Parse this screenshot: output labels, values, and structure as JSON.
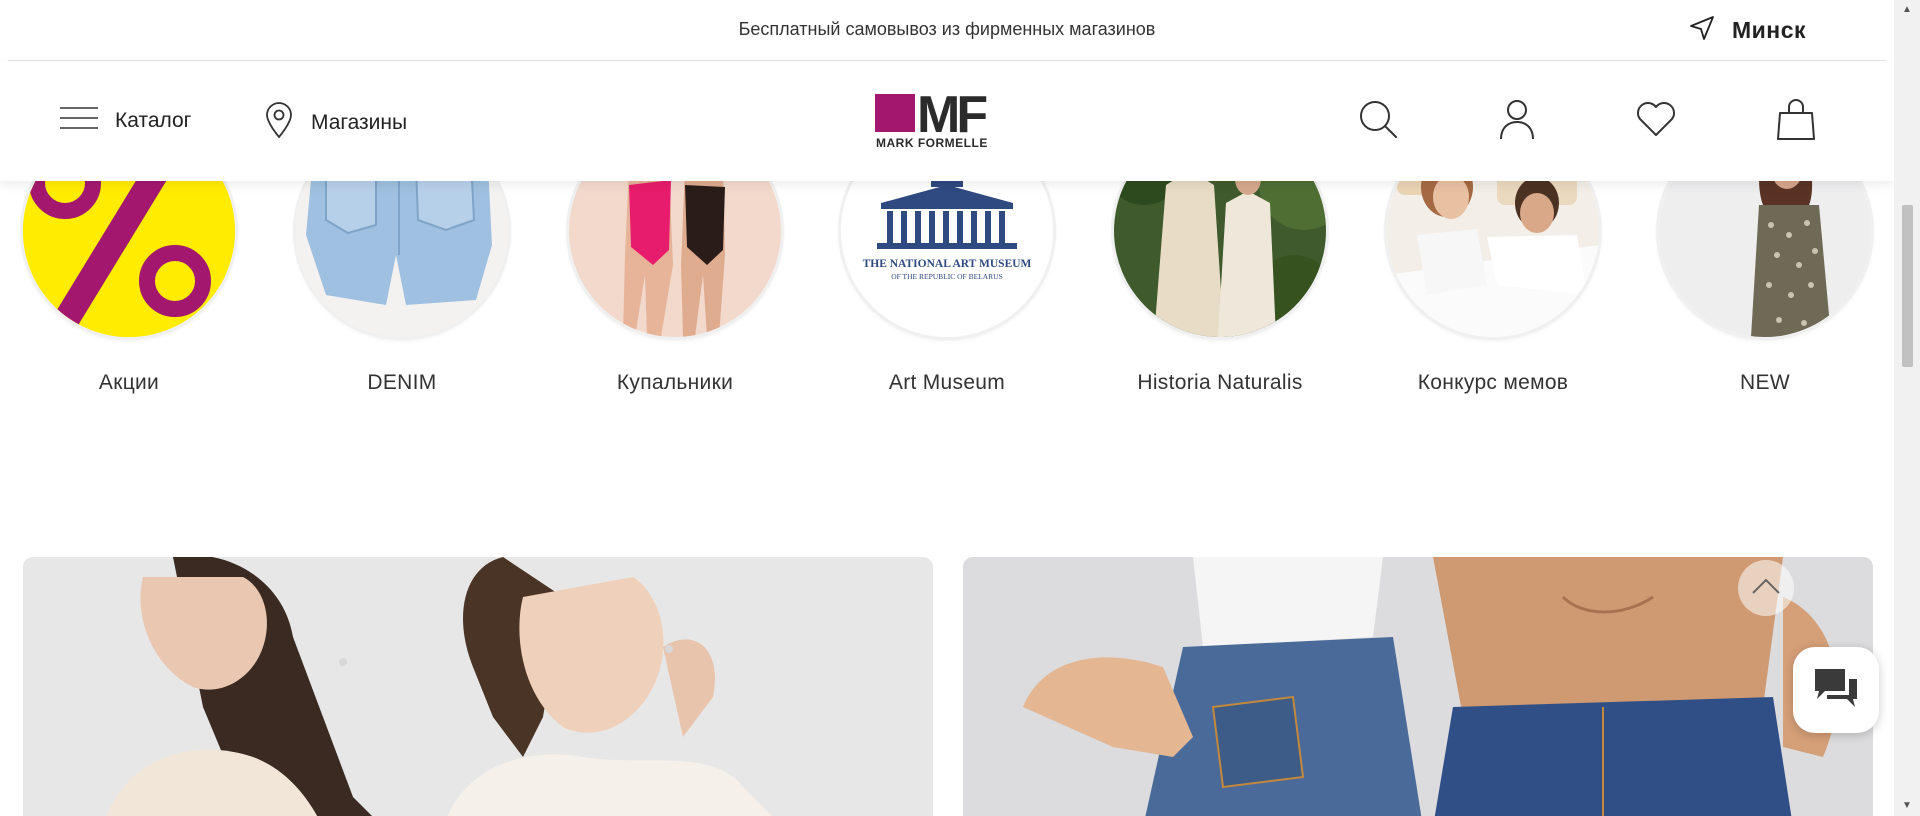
{
  "topbar": {
    "promo": "Бесплатный самовывоз из фирменных магазинов",
    "city": "Минск"
  },
  "header": {
    "catalog_label": "Каталог",
    "stores_label": "Магазины",
    "logo_mark": "MF",
    "logo_text": "MARK FORMELLE"
  },
  "colors": {
    "brand": "#a3186e",
    "promo_yellow": "#ffec00"
  },
  "categories": [
    {
      "label": "Акции"
    },
    {
      "label": "DENIM"
    },
    {
      "label": "Купальники"
    },
    {
      "label": "Art Museum",
      "image_text": "THE NATIONAL ART MUSEUM",
      "image_subtext": "OF THE REPUBLIC OF BELARUS"
    },
    {
      "label": "Historia Naturalis"
    },
    {
      "label": "Конкурс мемов"
    },
    {
      "label": "NEW"
    }
  ],
  "icons": {
    "location_arrow": "navigation-arrow-icon",
    "menu": "hamburger-menu-icon",
    "map_pin": "map-pin-icon",
    "search": "search-icon",
    "account": "user-icon",
    "favorites": "heart-icon",
    "cart": "shopping-bag-icon",
    "scroll_top": "chevron-up-icon",
    "chat": "chat-bubbles-icon"
  }
}
